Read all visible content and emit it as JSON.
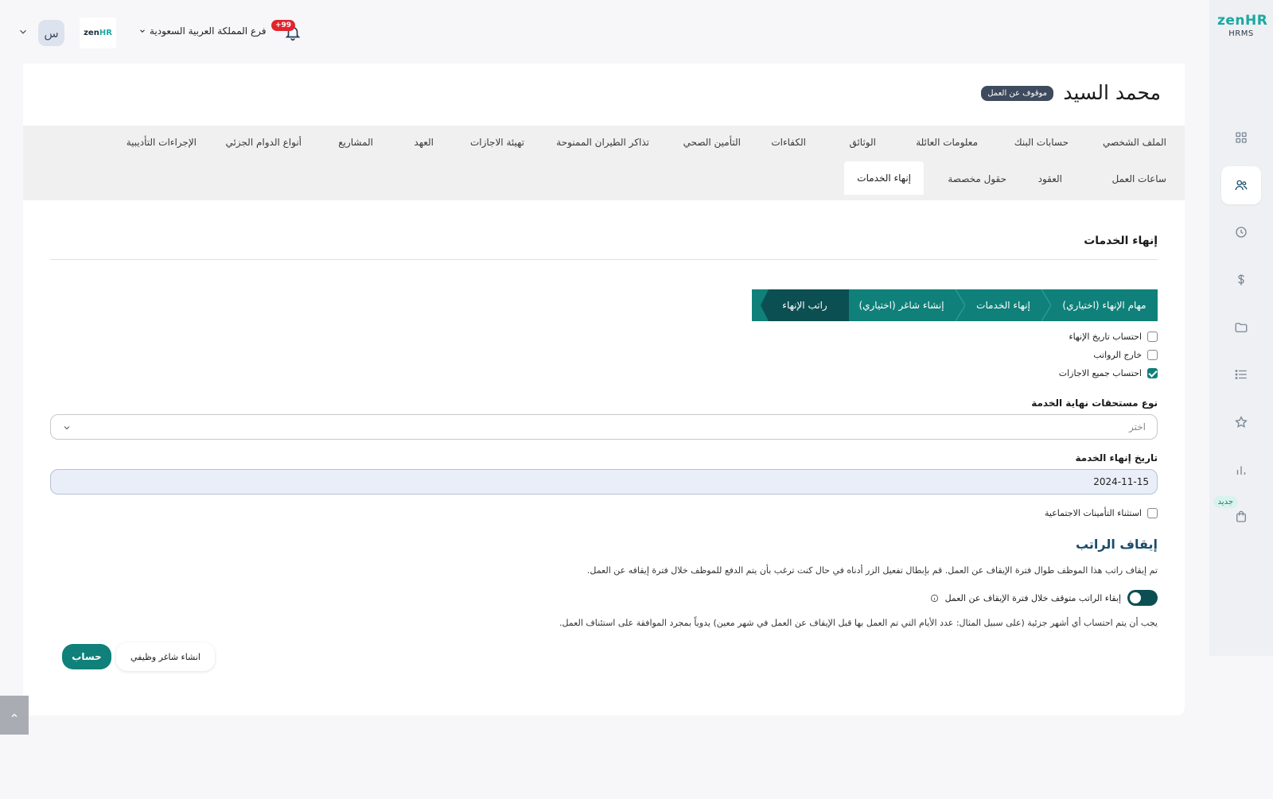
{
  "brand": {
    "zen": "zen",
    "hr": "HR",
    "sub": "HRMS"
  },
  "topbar": {
    "avatar_initial": "س",
    "logo_zen": "zen",
    "logo_hr": "HR",
    "branch": "فرع المملكة العربية السعودية",
    "notification_count": "+99"
  },
  "rail": {
    "new_badge": "جديد"
  },
  "employee": {
    "name": "محمد السيد",
    "status": "موقوف عن العمل"
  },
  "tabs": {
    "row1": [
      "الملف الشخصي",
      "حسابات البنك",
      "معلومات العائلة",
      "الوثائق",
      "الكفاءات",
      "التأمين الصحي",
      "تذاكر الطيران الممنوحة",
      "تهيئة الاجازات",
      "العهد",
      "المشاريع",
      "أنواع الدوام الجزئي",
      "الإجراءات التأديبية"
    ],
    "row2": [
      "ساعات العمل",
      "العقود",
      "حقول مخصصة",
      "إنهاء الخدمات"
    ]
  },
  "main": {
    "section_title": "إنهاء الخدمات",
    "steps": [
      "مهام الإنهاء (اختياري)",
      "إنهاء الخدمات",
      "إنشاء شاغر (اختياري)",
      "راتب الإنهاء"
    ],
    "checkboxes": [
      {
        "label": "احتساب تاريخ الإنهاء",
        "checked": false
      },
      {
        "label": "خارج الرواتب",
        "checked": false
      },
      {
        "label": "احتساب جميع الاجازات",
        "checked": true
      }
    ],
    "eos_type_label": "نوع مستحقات نهاية الخدمة",
    "eos_type_placeholder": "اختر",
    "end_date_label": "تاريخ إنهاء الخدمة",
    "end_date_value": "2024-11-15",
    "exclude_gosi_label": "استثناء التأمينات الاجتماعية",
    "stop_salary_title": "إيقاف الراتب",
    "stop_salary_desc": "تم إيقاف راتب هذا الموظف طوال فترة الإيقاف عن العمل. قم بإبطال تفعيل الزر أدناه في حال كنت ترغب بأن يتم الدفع للموظف خلال فترة إيقافه عن العمل.",
    "toggle_label": "إبقاء الراتب متوقف خلال فترة الإيقاف عن العمل",
    "note": "يجب أن يتم احتساب أي أشهر جزئية (على سبيل المثال: عدد الأيام التي تم العمل بها قبل الإيقاف عن العمل في شهر معين) يدوياً بمجرد الموافقة على استئناف العمل.",
    "calc_button": "حساب",
    "vacancy_button": "انشاء شاغر وظيفي"
  },
  "colors": {
    "primary": "#0f807a",
    "dark_step": "#0c4f52",
    "badge_red": "#e1252d"
  }
}
